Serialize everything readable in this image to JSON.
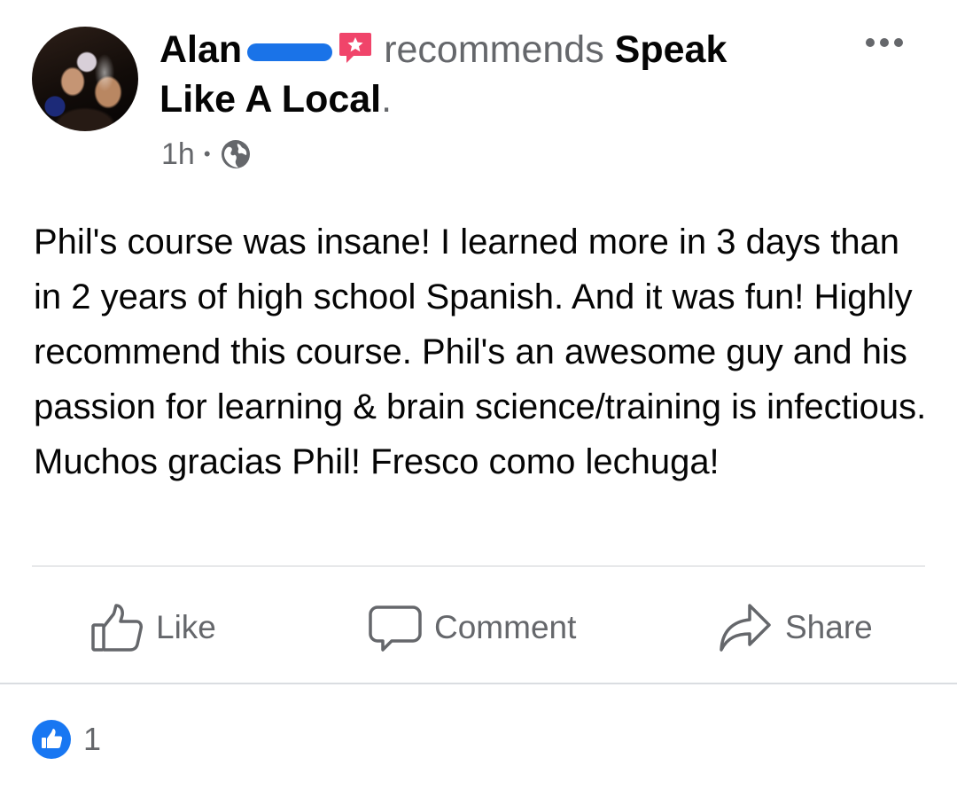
{
  "post": {
    "author_first": "Alan",
    "recommends_text": "recommends",
    "page_name_part1": "Speak",
    "page_name_part2": "Like A Local",
    "period": ".",
    "time": "1h",
    "separator": "•",
    "privacy_icon": "globe-icon",
    "recommend_icon": "star-speech-bubble-icon",
    "accent_color": "#1877f2",
    "body": "Phil's course was insane! I learned more in 3 days than in 2 years of high school Spanish. And it was fun! Highly recommend this course. Phil's an awesome guy and his passion for learning & brain science/training is infectious. Muchos gracias Phil! Fresco como lechuga!"
  },
  "actions": {
    "like": "Like",
    "comment": "Comment",
    "share": "Share"
  },
  "reactions": {
    "icon": "like-thumb-icon",
    "count": "1"
  }
}
